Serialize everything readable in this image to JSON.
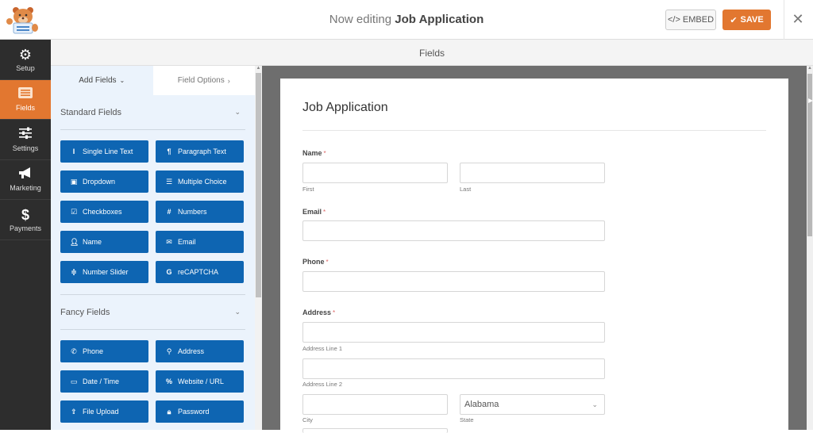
{
  "header": {
    "title_prefix": "Now editing",
    "title_form": "Job Application",
    "embed_label": "EMBED",
    "save_label": "SAVE",
    "close_icon": "close-icon"
  },
  "sidebar": {
    "items": [
      {
        "label": "Setup",
        "icon": "gear-icon",
        "active": false
      },
      {
        "label": "Fields",
        "icon": "fields-list-icon",
        "active": true
      },
      {
        "label": "Settings",
        "icon": "sliders-icon",
        "active": false
      },
      {
        "label": "Marketing",
        "icon": "megaphone-icon",
        "active": false
      },
      {
        "label": "Payments",
        "icon": "dollar-icon",
        "active": false
      }
    ]
  },
  "subbar": {
    "title": "Fields"
  },
  "panel": {
    "tabs": [
      {
        "label": "Add Fields",
        "active": true
      },
      {
        "label": "Field Options",
        "active": false
      }
    ],
    "standard": {
      "title": "Standard Fields",
      "fields": [
        {
          "label": "Single Line Text",
          "icon": "text-cursor-icon"
        },
        {
          "label": "Paragraph Text",
          "icon": "paragraph-icon"
        },
        {
          "label": "Dropdown",
          "icon": "dropdown-icon"
        },
        {
          "label": "Multiple Choice",
          "icon": "list-icon"
        },
        {
          "label": "Checkboxes",
          "icon": "checkbox-icon"
        },
        {
          "label": "Numbers",
          "icon": "hash-icon"
        },
        {
          "label": "Name",
          "icon": "user-icon"
        },
        {
          "label": "Email",
          "icon": "envelope-icon"
        },
        {
          "label": "Number Slider",
          "icon": "slider-icon"
        },
        {
          "label": "reCAPTCHA",
          "icon": "google-icon"
        }
      ]
    },
    "fancy": {
      "title": "Fancy Fields",
      "fields": [
        {
          "label": "Phone",
          "icon": "phone-icon"
        },
        {
          "label": "Address",
          "icon": "map-marker-icon"
        },
        {
          "label": "Date / Time",
          "icon": "calendar-icon"
        },
        {
          "label": "Website / URL",
          "icon": "link-icon"
        },
        {
          "label": "File Upload",
          "icon": "upload-icon"
        },
        {
          "label": "Password",
          "icon": "lock-icon"
        }
      ]
    }
  },
  "form": {
    "title": "Job Application",
    "required_mark": "*",
    "name": {
      "label": "Name",
      "first": "First",
      "last": "Last",
      "first_value": "",
      "last_value": ""
    },
    "email": {
      "label": "Email",
      "value": ""
    },
    "phone": {
      "label": "Phone",
      "value": ""
    },
    "address": {
      "label": "Address",
      "line1": "Address Line 1",
      "line2": "Address Line 2",
      "city": "City",
      "state": "State",
      "state_value": "Alabama"
    }
  }
}
